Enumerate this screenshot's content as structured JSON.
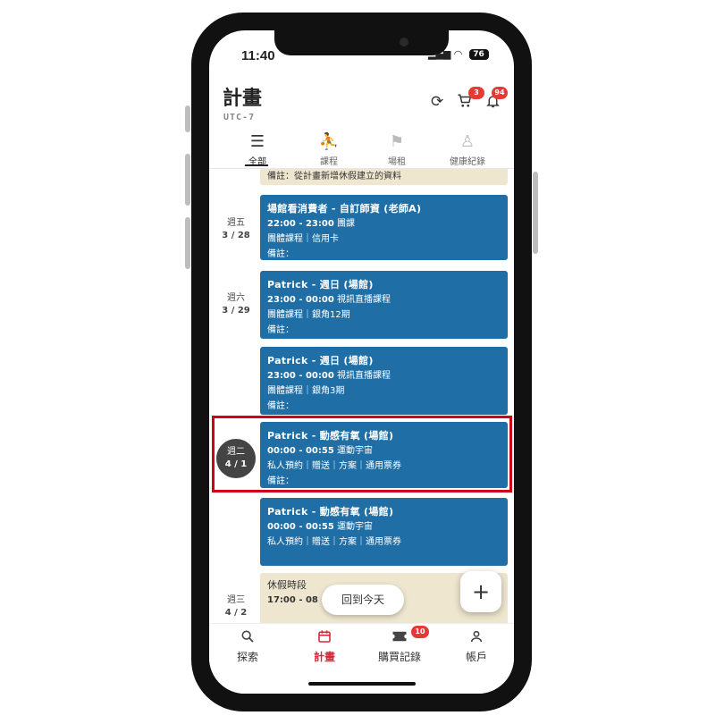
{
  "status_bar": {
    "time": "11:40",
    "battery": "76"
  },
  "header": {
    "title": "計畫",
    "timezone": "UTC-7",
    "cart_badge": "3",
    "notification_badge": "94"
  },
  "tabs": [
    {
      "label": "全部",
      "active": true
    },
    {
      "label": "課程",
      "active": false
    },
    {
      "label": "場租",
      "active": false
    },
    {
      "label": "健康紀錄",
      "active": false
    }
  ],
  "schedule": {
    "top_note": "備註：從計畫新增休假建立的資料",
    "days": [
      {
        "weekday": "週五",
        "date": "3 / 28"
      },
      {
        "weekday": "週六",
        "date": "3 / 29"
      },
      {
        "weekday": "週二",
        "date": "4 / 1"
      },
      {
        "weekday": "週三",
        "date": "4 / 2"
      }
    ],
    "cards": [
      {
        "title": "場館看消費者 - 自訂師資 (老師A)",
        "time": "22:00 - 23:00",
        "type": "團課",
        "detail": "團體課程｜信用卡",
        "note": "備註："
      },
      {
        "title": "Patrick  - 週日 (場館)",
        "time": "23:00 - 00:00",
        "type": "視訊直播課程",
        "detail": "團體課程｜銀角12期",
        "note": "備註："
      },
      {
        "title": "Patrick  - 週日 (場館)",
        "time": "23:00 - 00:00",
        "type": "視訊直播課程",
        "detail": "團體課程｜銀角3期",
        "note": "備註："
      },
      {
        "title": "Patrick  - 動感有氧 (場館)",
        "time": "00:00 - 00:55",
        "type": "運動宇宙",
        "detail": "私人預約｜贈送｜方案｜通用票券",
        "note": "備註："
      },
      {
        "title": "Patrick  - 動感有氧 (場館)",
        "time": "00:00 - 00:55",
        "type": "運動宇宙",
        "detail": "私人預約｜贈送｜方案｜通用票券",
        "note": ""
      }
    ],
    "leave": {
      "title": "休假時段",
      "time": "17:00 - 08"
    }
  },
  "today_button": "回到今天",
  "bottom_nav": [
    {
      "label": "探索",
      "active": false
    },
    {
      "label": "計畫",
      "active": true
    },
    {
      "label": "購買記錄",
      "active": false,
      "badge": "10"
    },
    {
      "label": "帳戶",
      "active": false
    }
  ],
  "colors": {
    "card_blue": "#1f6fa6",
    "leave_beige": "#efe6cf",
    "accent_red": "#d6283c",
    "highlight": "#d0021b"
  }
}
